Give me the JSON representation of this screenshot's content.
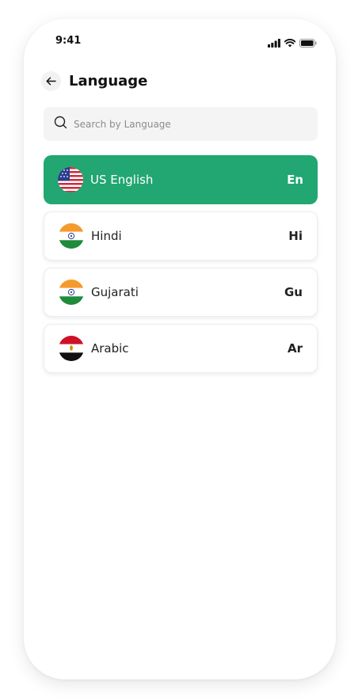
{
  "status_bar": {
    "time": "9:41",
    "icons": [
      "signal-icon",
      "wifi-icon",
      "battery-icon"
    ]
  },
  "header": {
    "back_icon": "arrow-left-icon",
    "title": "Language"
  },
  "search": {
    "icon": "search-icon",
    "placeholder": "Search by Language",
    "value": ""
  },
  "languages": [
    {
      "name": "US English",
      "code": "En",
      "flag": "us-flag-icon",
      "selected": true
    },
    {
      "name": "Hindi",
      "code": "Hi",
      "flag": "india-flag-icon",
      "selected": false
    },
    {
      "name": "Gujarati",
      "code": "Gu",
      "flag": "india-flag-icon",
      "selected": false
    },
    {
      "name": "Arabic",
      "code": "Ar",
      "flag": "egypt-flag-icon",
      "selected": false
    }
  ],
  "colors": {
    "accent": "#22a672",
    "search_bg": "#f4f4f4",
    "text": "#222222"
  }
}
